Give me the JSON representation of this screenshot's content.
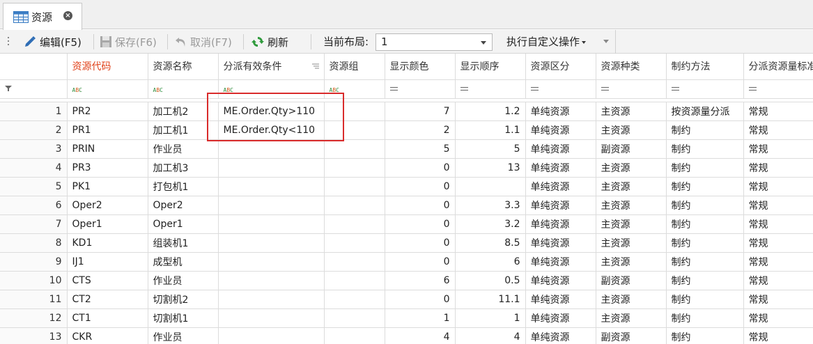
{
  "tab": {
    "title": "资源",
    "close": "×"
  },
  "toolbar": {
    "edit": "编辑(F5)",
    "save": "保存(F6)",
    "cancel": "取消(F7)",
    "refresh": "刷新",
    "layout_label": "当前布局:",
    "layout_value": "1",
    "custom_ops": "执行自定义操作"
  },
  "columns": [
    "",
    "资源代码",
    "资源名称",
    "分派有效条件",
    "资源组",
    "显示颜色",
    "显示顺序",
    "资源区分",
    "资源种类",
    "制约方法",
    "分派资源量标准"
  ],
  "rows": [
    [
      "1",
      "PR2",
      "加工机2",
      "ME.Order.Qty>110",
      "",
      "7",
      "1.2",
      "单纯资源",
      "主资源",
      "按资源量分派",
      "常规"
    ],
    [
      "2",
      "PR1",
      "加工机1",
      "ME.Order.Qty<110",
      "",
      "2",
      "1.1",
      "单纯资源",
      "主资源",
      "制约",
      "常规"
    ],
    [
      "3",
      "PRIN",
      "作业员",
      "",
      "",
      "5",
      "5",
      "单纯资源",
      "副资源",
      "制约",
      "常规"
    ],
    [
      "4",
      "PR3",
      "加工机3",
      "",
      "",
      "0",
      "13",
      "单纯资源",
      "主资源",
      "制约",
      "常规"
    ],
    [
      "5",
      "PK1",
      "打包机1",
      "",
      "",
      "0",
      "",
      "单纯资源",
      "主资源",
      "制约",
      "常规"
    ],
    [
      "6",
      "Oper2",
      "Oper2",
      "",
      "",
      "0",
      "3.3",
      "单纯资源",
      "主资源",
      "制约",
      "常规"
    ],
    [
      "7",
      "Oper1",
      "Oper1",
      "",
      "",
      "0",
      "3.2",
      "单纯资源",
      "主资源",
      "制约",
      "常规"
    ],
    [
      "8",
      "KD1",
      "组装机1",
      "",
      "",
      "0",
      "8.5",
      "单纯资源",
      "主资源",
      "制约",
      "常规"
    ],
    [
      "9",
      "IJ1",
      "成型机",
      "",
      "",
      "0",
      "6",
      "单纯资源",
      "主资源",
      "制约",
      "常规"
    ],
    [
      "10",
      "CTS",
      "作业员",
      "",
      "",
      "6",
      "0.5",
      "单纯资源",
      "副资源",
      "制约",
      "常规"
    ],
    [
      "11",
      "CT2",
      "切割机2",
      "",
      "",
      "0",
      "11.1",
      "单纯资源",
      "主资源",
      "制约",
      "常规"
    ],
    [
      "12",
      "CT1",
      "切割机1",
      "",
      "",
      "1",
      "1",
      "单纯资源",
      "主资源",
      "制约",
      "常规"
    ],
    [
      "13",
      "CKR",
      "作业员",
      "",
      "",
      "4",
      "4",
      "单纯资源",
      "副资源",
      "制约",
      "常规"
    ]
  ],
  "colors": {
    "key_header": "#e0431c",
    "highlight": "#d92b2b"
  }
}
